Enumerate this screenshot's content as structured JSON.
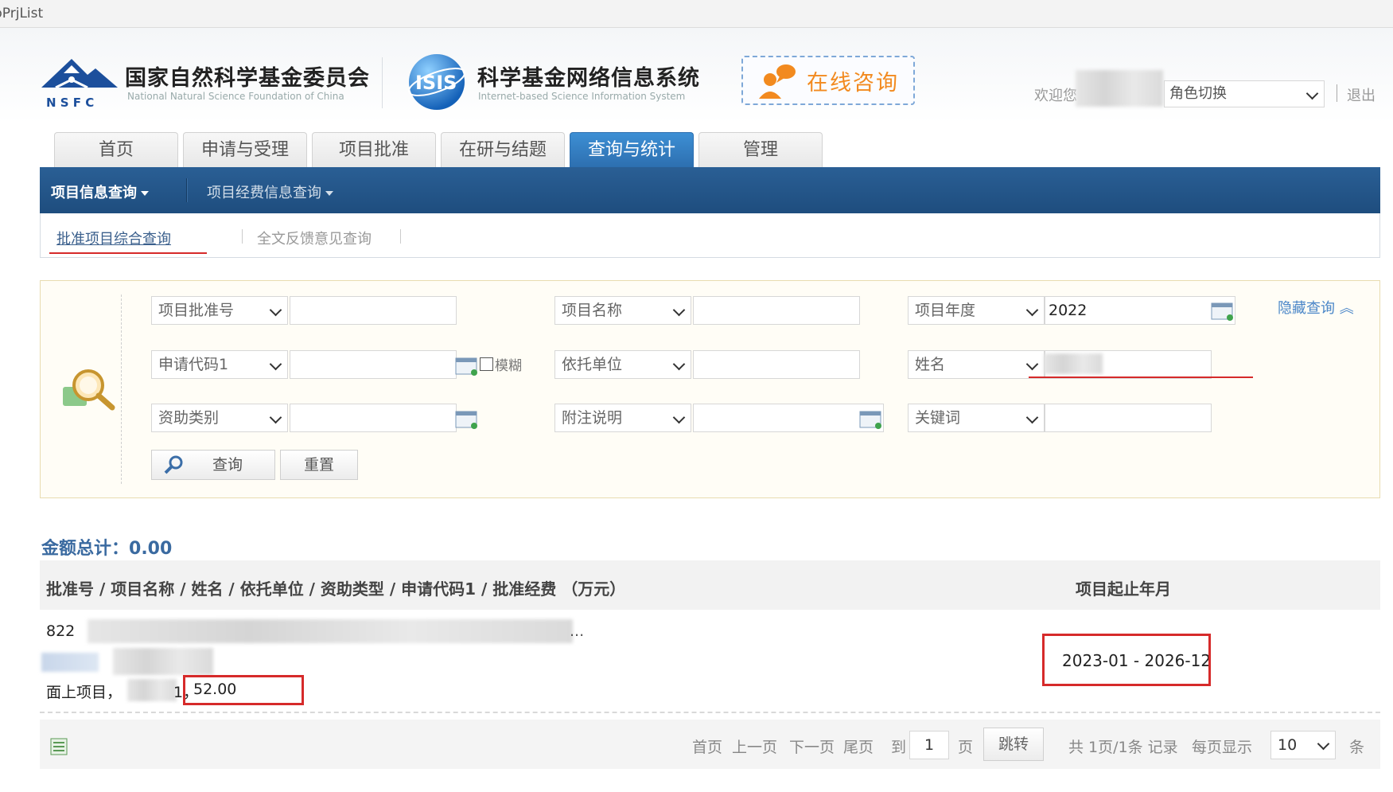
{
  "window": {
    "title": "bPrjList"
  },
  "header": {
    "org_cn": "国家自然科学基金委员会",
    "org_en": "National Natural Science Foundation of China",
    "org_abbr": "N S F C",
    "sys_cn": "科学基金网络信息系统",
    "sys_en": "Internet-based Science Information System",
    "isis_logo_text": "ISIS",
    "consult_label": "在线咨询",
    "welcome": "欢迎您",
    "role_switch": "角色切换",
    "logout": "退出"
  },
  "tabs": [
    "首页",
    "申请与受理",
    "项目批准",
    "在研与结题",
    "查询与统计",
    "管理"
  ],
  "active_tab": "查询与统计",
  "subnav": {
    "item1": "项目信息查询",
    "item2": "项目经费信息查询"
  },
  "subtabs": {
    "a": "批准项目综合查询",
    "b": "全文反馈意见查询"
  },
  "search": {
    "f1_select": "项目批准号",
    "f1_value": "",
    "f2_select": "项目名称",
    "f2_value": "",
    "f3_select": "项目年度",
    "f3_value": "2022",
    "f4_select": "申请代码1",
    "f4_value": "",
    "fuzzy_label": "模糊",
    "f5_select": "依托单位",
    "f5_value": "",
    "f6_select": "姓名",
    "f6_value": "",
    "f7_select": "资助类别",
    "f7_value": "",
    "f8_select": "附注说明",
    "f8_value": "",
    "f9_select": "关键词",
    "f9_value": "",
    "hide_label": "隐藏查询",
    "query_btn": "查询",
    "reset_btn": "重置"
  },
  "summary": {
    "label": "金额总计：",
    "value": "0.00"
  },
  "table": {
    "col_left": "批准号 / 项目名称 / 姓名 / 依托单位 / 资助类型 / 申请代码1 / 批准经费 （万元）",
    "col_right": "项目起止年月",
    "row": {
      "approval_prefix": "822",
      "ellipsis": "...",
      "type_text": "面上项目，",
      "code_tail": "1，",
      "amount": "52.00",
      "period": "2023-01 - 2026-12"
    }
  },
  "pager": {
    "first": "首页",
    "prev": "上一页",
    "next": "下一页",
    "last": "尾页",
    "to": "到",
    "page_value": "1",
    "page_unit": "页",
    "jump": "跳转",
    "summary": "共 1页/1条 记录",
    "per_page_label": "每页显示",
    "per_page_value": "10",
    "per_page_unit": "条"
  },
  "colors": {
    "accent_blue": "#2a5f95",
    "active_tab": "#3d8fd4",
    "highlight_red": "#d62a2a",
    "consult_orange": "#f28a1f"
  }
}
